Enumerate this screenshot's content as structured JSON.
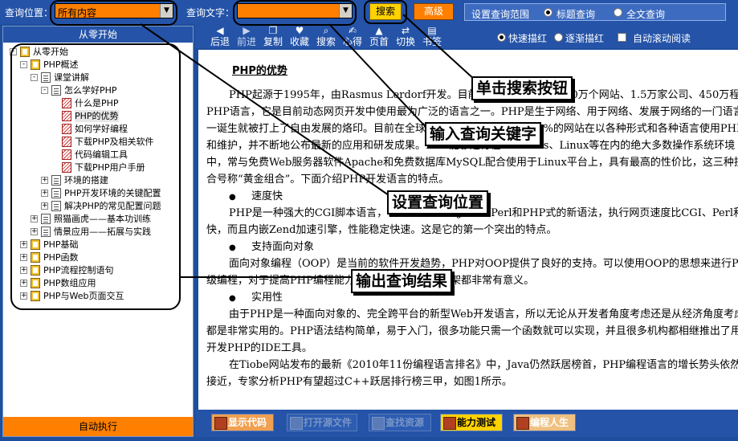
{
  "topbar": {
    "query_location_label": "查询位置：",
    "query_location_value": "所有内容",
    "query_text_label": "查询文字：",
    "query_text_value": "",
    "search_button": "搜索",
    "advanced_button": "高级",
    "range_label": "设置查询范围",
    "range_options": [
      "标题查询",
      "全文查询"
    ],
    "range_selected": "标题查询"
  },
  "left_panel": {
    "header": "从零开始",
    "run_button": "自动执行",
    "tree": [
      {
        "label": "从零开始",
        "icon": "open-book-icon"
      },
      {
        "label": "PHP概述",
        "icon": "book-icon"
      },
      {
        "label": "课堂讲解",
        "icon": "document-icon"
      },
      {
        "label": "怎么学好PHP",
        "icon": "document-icon"
      },
      {
        "label": "什么是PHP",
        "icon": "page-icon"
      },
      {
        "label": "PHP的优势",
        "icon": "page-icon"
      },
      {
        "label": "如何学好编程",
        "icon": "page-icon"
      },
      {
        "label": "下载PHP及相关软件",
        "icon": "page-icon"
      },
      {
        "label": "代码编辑工具",
        "icon": "page-icon"
      },
      {
        "label": "下载PHP用户手册",
        "icon": "page-icon"
      },
      {
        "label": "环境的搭建",
        "icon": "document-icon"
      },
      {
        "label": "PHP开发环境的关键配置",
        "icon": "document-icon"
      },
      {
        "label": "解决PHP的常见配置问题",
        "icon": "document-icon"
      },
      {
        "label": "照猫画虎——基本功训练",
        "icon": "document-icon"
      },
      {
        "label": "情景应用——拓展与实践",
        "icon": "document-icon"
      },
      {
        "label": "PHP基础",
        "icon": "book-icon"
      },
      {
        "label": "PHP函数",
        "icon": "book-icon"
      },
      {
        "label": "PHP流程控制语句",
        "icon": "book-icon"
      },
      {
        "label": "PHP数组应用",
        "icon": "book-icon"
      },
      {
        "label": "PHP与Web页面交互",
        "icon": "book-icon"
      }
    ]
  },
  "navbar": {
    "buttons": [
      {
        "label": "后退",
        "icon": "back-arrow-icon"
      },
      {
        "label": "前进",
        "icon": "forward-arrow-icon"
      },
      {
        "label": "复制",
        "icon": "copy-icon"
      },
      {
        "label": "收藏",
        "icon": "favorite-icon"
      },
      {
        "label": "搜索",
        "icon": "search-icon"
      },
      {
        "label": "心得",
        "icon": "notes-icon"
      },
      {
        "label": "页首",
        "icon": "page-top-icon"
      },
      {
        "label": "切换",
        "icon": "switch-icon"
      },
      {
        "label": "书签",
        "icon": "bookmark-icon"
      }
    ],
    "options": [
      "快速描红",
      "逐渐描红",
      "自动滚动阅读"
    ]
  },
  "article": {
    "title": "PHP的优势",
    "lines": [
      "PHP起源于1995年，由Rasmus Lerdorf开发。目前，全世界有超过2200万个网站、1.5万家公司、450万程序开发人员在使用",
      "PHP语言，它是目前动态网页开发中使用最为广泛的语言之一。PHP是生于网络、用于网络、发展于网络的一门语言。它从",
      "一诞生就被打上了自由发展的烙印。目前在全球所有的网站中，有超过60%的网站在以各种形式和各种语言使用PHP进行开发",
      "和维护，并不断地公布最新的应用和研发成果。PHP能够运行在Windows、Linux等在内的绝大多数操作系统环境",
      "中，常与免费Web服务器软件Apache和免费数据库MySQL配合使用于Linux平台上，具有最高的性价比，这三种技术",
      "合号称“黄金组合”。下面介绍PHP开发语言的特点。"
    ],
    "bullet1": "速度快",
    "para2": [
      "PHP是一种强大的CGI脚本语言，语法混合了C、Java、Perl和PHP式的新语法，执行网页速度比CGI、Perl和ASP更",
      "快，而且内嵌Zend加速引擎，性能稳定快速。这是它的第一个突出的特点。"
    ],
    "bullet2": "支持面向对象",
    "para3": [
      "面向对象编程（OOP）是当前的软件开发趋势，PHP对OOP提供了良好的支持。可以使用OOP的思想来进行PHP的高",
      "级编程，对于提高PHP编程能力和规划好Web开发构架都非常有意义。"
    ],
    "bullet3": "实用性",
    "para4": [
      "由于PHP是一种面向对象的、完全跨平台的新型Web开发语言，所以无论从开发者角度考虑还是从经济角度考虑，",
      "都是非常实用的。PHP语法结构简单，易于入门，很多功能只需一个函数就可以实现，并且很多机构都相继推出了用于",
      "开发PHP的IDE工具。",
      "在Tiobe网站发布的最新《2010年11份编程语言排名》中，Java仍然跃居榜首，PHP编程语言的增长势头依然",
      "接近，专家分析PHP有望超过C++跃居排行榜三甲，如图1所示。"
    ]
  },
  "bottombar": {
    "buttons": [
      "显示代码",
      "打开源文件",
      "查找资源",
      "能力测试",
      "编程人生"
    ]
  },
  "callouts": {
    "search_button": "单击搜索按钮",
    "query_keyword": "输入查询关键字",
    "query_location": "设置查询位置",
    "query_result": "输出查询结果"
  }
}
